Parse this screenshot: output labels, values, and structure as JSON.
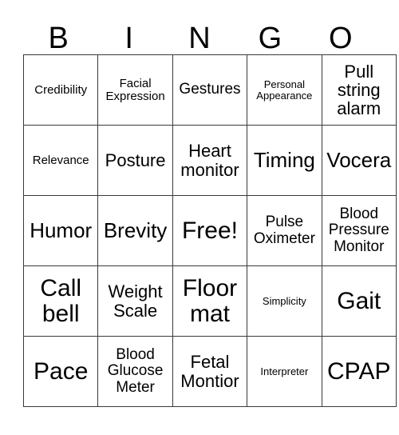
{
  "card": {
    "title": "BINGO",
    "header_letters": [
      "B",
      "I",
      "N",
      "G",
      "O"
    ],
    "rows": [
      [
        {
          "label": "Credibility",
          "size": "sm"
        },
        {
          "label": "Facial Expression",
          "size": "sm"
        },
        {
          "label": "Gestures",
          "size": "md"
        },
        {
          "label": "Personal Appearance",
          "size": "xs"
        },
        {
          "label": "Pull string alarm",
          "size": "lg"
        }
      ],
      [
        {
          "label": "Relevance",
          "size": "sm"
        },
        {
          "label": "Posture",
          "size": "lg"
        },
        {
          "label": "Heart monitor",
          "size": "lg"
        },
        {
          "label": "Timing",
          "size": "xl"
        },
        {
          "label": "Vocera",
          "size": "xl"
        }
      ],
      [
        {
          "label": "Humor",
          "size": "xl"
        },
        {
          "label": "Brevity",
          "size": "xl"
        },
        {
          "label": "Free!",
          "size": "xxl"
        },
        {
          "label": "Pulse Oximeter",
          "size": "md"
        },
        {
          "label": "Blood Pressure Monitor",
          "size": "md"
        }
      ],
      [
        {
          "label": "Call bell",
          "size": "xxl"
        },
        {
          "label": "Weight Scale",
          "size": "lg"
        },
        {
          "label": "Floor mat",
          "size": "xxl"
        },
        {
          "label": "Simplicity",
          "size": "xs"
        },
        {
          "label": "Gait",
          "size": "xxl"
        }
      ],
      [
        {
          "label": "Pace",
          "size": "xxl"
        },
        {
          "label": "Blood Glucose Meter",
          "size": "md"
        },
        {
          "label": "Fetal Montior",
          "size": "lg"
        },
        {
          "label": "Interpreter",
          "size": "xs"
        },
        {
          "label": "CPAP",
          "size": "xxl"
        }
      ]
    ],
    "colors": {
      "background": "#ffffff",
      "text": "#000000",
      "border": "#3a3a3a"
    }
  }
}
